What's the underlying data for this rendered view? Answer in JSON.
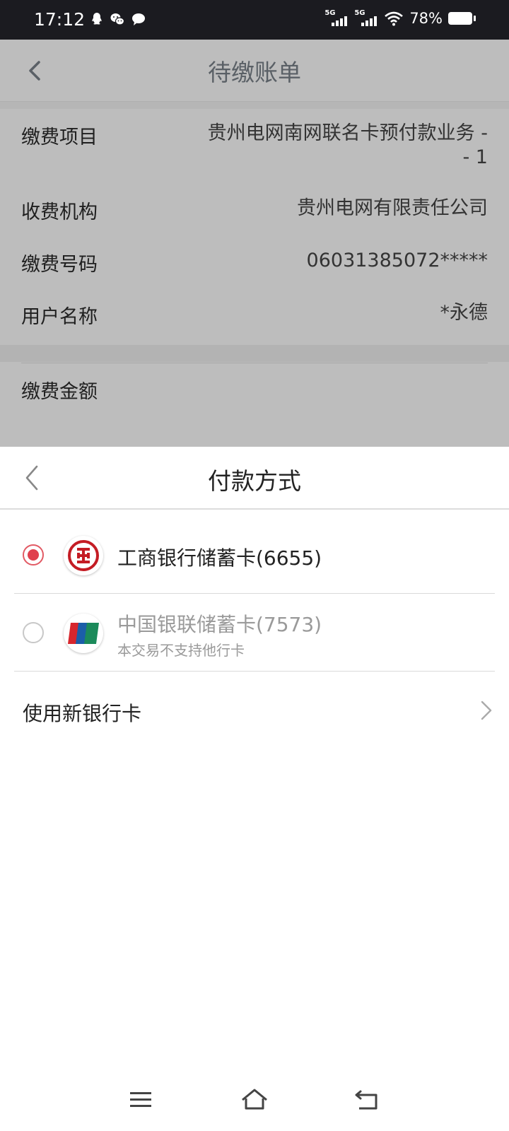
{
  "status_bar": {
    "time": "17:12",
    "signal1_label": "5G",
    "signal2_label": "5G",
    "battery": "78%",
    "notification_icons": [
      "qq-icon",
      "wechat-icon",
      "message-icon"
    ]
  },
  "background_page": {
    "title": "待缴账单",
    "rows": [
      {
        "key": "缴费项目",
        "value": "贵州电网南网联名卡预付款业务 -\n- 1"
      },
      {
        "key": "收费机构",
        "value": "贵州电网有限责任公司"
      },
      {
        "key": "缴费号码",
        "value": "06031385072*****"
      },
      {
        "key": "用户名称",
        "value": "*永德"
      }
    ],
    "amount_label": "缴费金额"
  },
  "sheet": {
    "title": "付款方式",
    "options": [
      {
        "name": "工商银行储蓄卡(6655)",
        "selected": true,
        "disabled": false,
        "logo": "icbc-logo-icon"
      },
      {
        "name": "中国银联储蓄卡(7573)",
        "selected": false,
        "disabled": true,
        "subtitle": "本交易不支持他行卡",
        "logo": "unionpay-logo-icon"
      }
    ],
    "new_card_label": "使用新银行卡"
  },
  "colors": {
    "accent": "#e0404e",
    "status_bar_bg": "#1b1b20",
    "dim_bg": "#bdbdbd",
    "unionpay_red": "#d7262d",
    "unionpay_blue": "#1b5ea8",
    "unionpay_green": "#1b8a5a"
  }
}
